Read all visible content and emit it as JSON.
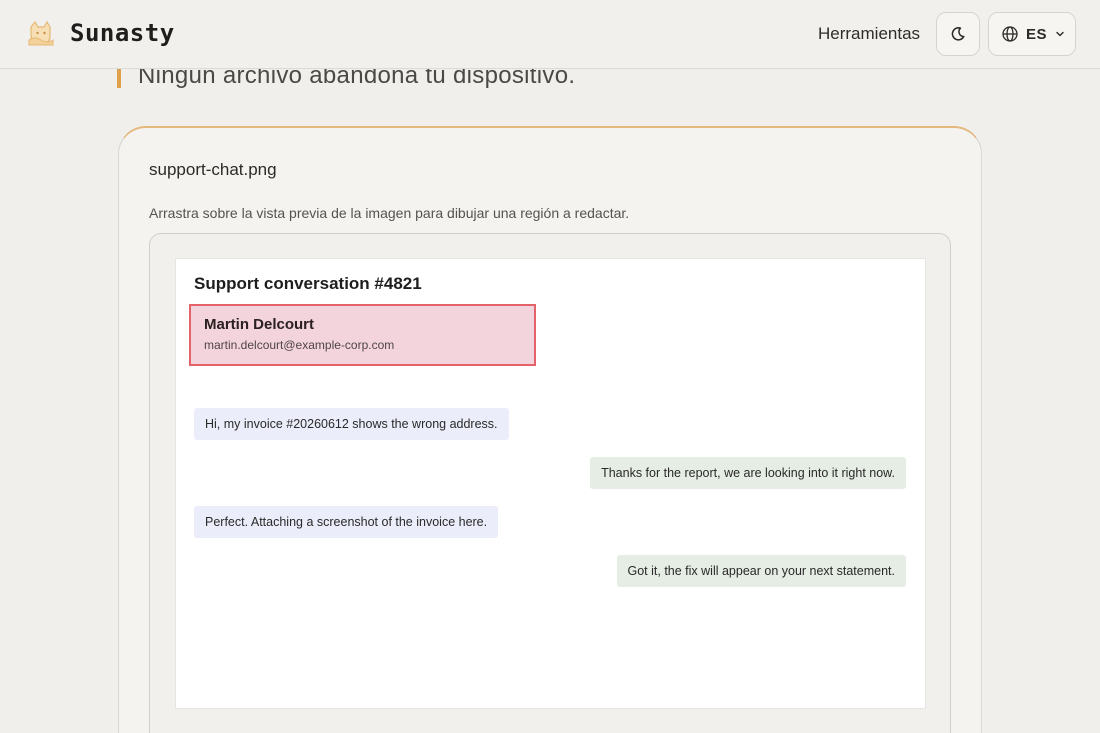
{
  "header": {
    "brand": "Sunasty",
    "tools_link": "Herramientas",
    "language_code": "ES"
  },
  "tagline": "Ningún archivo abandona tu dispositivo.",
  "editor": {
    "file_name": "support-chat.png",
    "hint": "Arrastra sobre la vista previa de la imagen para dibujar una región a redactar."
  },
  "preview": {
    "title": "Support conversation #4821",
    "contact_name": "Martin Delcourt",
    "contact_email": "martin.delcourt@example-corp.com",
    "messages": [
      {
        "side": "left",
        "text": "Hi, my invoice #20260612 shows the wrong address."
      },
      {
        "side": "right",
        "text": "Thanks for the report, we are looking into it right now."
      },
      {
        "side": "left",
        "text": "Perfect. Attaching a screenshot of the invoice here."
      },
      {
        "side": "right",
        "text": "Got it, the fix will appear on your next statement."
      }
    ]
  },
  "colors": {
    "accent": "#e0a049",
    "redaction_fill": "#f3d3dc",
    "redaction_border": "#e4636b"
  }
}
